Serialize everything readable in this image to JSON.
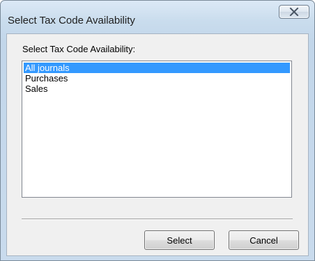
{
  "window": {
    "title": "Select Tax Code Availability"
  },
  "dialog": {
    "prompt": "Select Tax Code Availability:",
    "list": {
      "selected_index": 0,
      "items": [
        {
          "label": "All journals"
        },
        {
          "label": "Purchases"
        },
        {
          "label": "Sales"
        }
      ]
    },
    "buttons": {
      "select_label": "Select",
      "cancel_label": "Cancel"
    }
  },
  "icons": {
    "close": "close-icon"
  },
  "colors": {
    "selection": "#3399ff",
    "selection_text": "#ffffff"
  }
}
